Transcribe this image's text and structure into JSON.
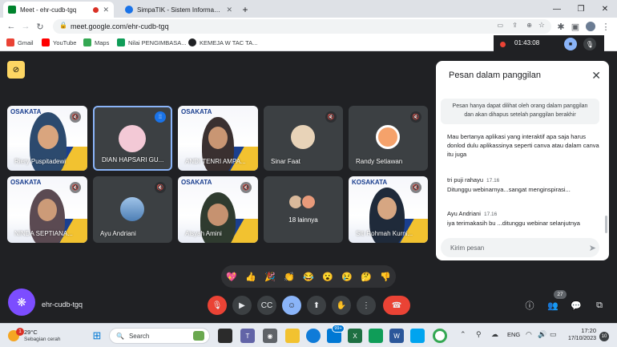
{
  "browser": {
    "tabs": [
      {
        "label": "Meet - ehr-cudb-tgq",
        "active": true,
        "color": "#00832d"
      },
      {
        "label": "SimpaTIK - Sistem Informasi Ma",
        "active": false,
        "color": "#1a73e8"
      }
    ],
    "new_tab": "+",
    "url": "meet.google.com/ehr-cudb-tgq",
    "bookmarks": [
      {
        "label": "Gmail",
        "color": "#ea4335"
      },
      {
        "label": "YouTube",
        "color": "#ff0000"
      },
      {
        "label": "Maps",
        "color": "#34a853"
      },
      {
        "label": "Nilai PENGIMBASA...",
        "color": "#0f9d58"
      },
      {
        "label": "KEMEJA W TAC TA...",
        "color": "#202124"
      }
    ],
    "recording_time": "01:43:08"
  },
  "meet": {
    "participants": [
      {
        "name": "Riery Puspitadewi",
        "muted": true
      },
      {
        "name": "DIAN HAPSARI GU...",
        "muted": false,
        "speaking": true
      },
      {
        "name": "ANDI TENRI AMPA...",
        "muted": true
      },
      {
        "name": "Sinar Faat",
        "muted": true
      },
      {
        "name": "Randy Setiawan",
        "muted": true
      },
      {
        "name": "NINDA SEPTIANA...",
        "muted": true
      },
      {
        "name": "Ayu Andriani",
        "muted": true
      },
      {
        "name": "Aisyah Amini",
        "muted": true
      },
      {
        "name": "18 lainnya",
        "muted": false
      },
      {
        "name": "Siti Rohmah Kurni...",
        "muted": true
      }
    ],
    "poster_brand": "OSAKATA",
    "poster_brand_last": "KOSAKATA",
    "meeting_code": "ehr-cudb-tgq",
    "participant_count": "27",
    "reactions": [
      "💖",
      "👍",
      "🎉",
      "👏",
      "😂",
      "😮",
      "😢",
      "🤔",
      "👎"
    ]
  },
  "chat": {
    "title": "Pesan dalam panggilan",
    "notice": "Pesan hanya dapat dilihat oleh orang dalam panggilan dan akan dihapus setelah panggilan berakhir",
    "messages": [
      {
        "sender": "",
        "time": "",
        "text": "Mau bertanya aplikasi yang interaktif apa saja harus donlod dulu aplikassinya seperti canva atau dalam canva itu juga"
      },
      {
        "sender": "tri puji rahayu",
        "time": "17.16",
        "text": "Ditunggu webinarnya...sangat menginspirasi..."
      },
      {
        "sender": "Ayu Andriani",
        "time": "17.16",
        "text": "iya terimakasih bu ...ditunggu webinar selanjutnya"
      }
    ],
    "input_placeholder": "Kirim pesan"
  },
  "taskbar": {
    "weather_temp": "29°C",
    "weather_desc": "Sebagian cerah",
    "weather_badge": "1",
    "search_label": "Search",
    "notif_badge": "99+",
    "lang": "ENG",
    "time": "17:20",
    "date": "17/10/2023",
    "notif_count": "10"
  }
}
